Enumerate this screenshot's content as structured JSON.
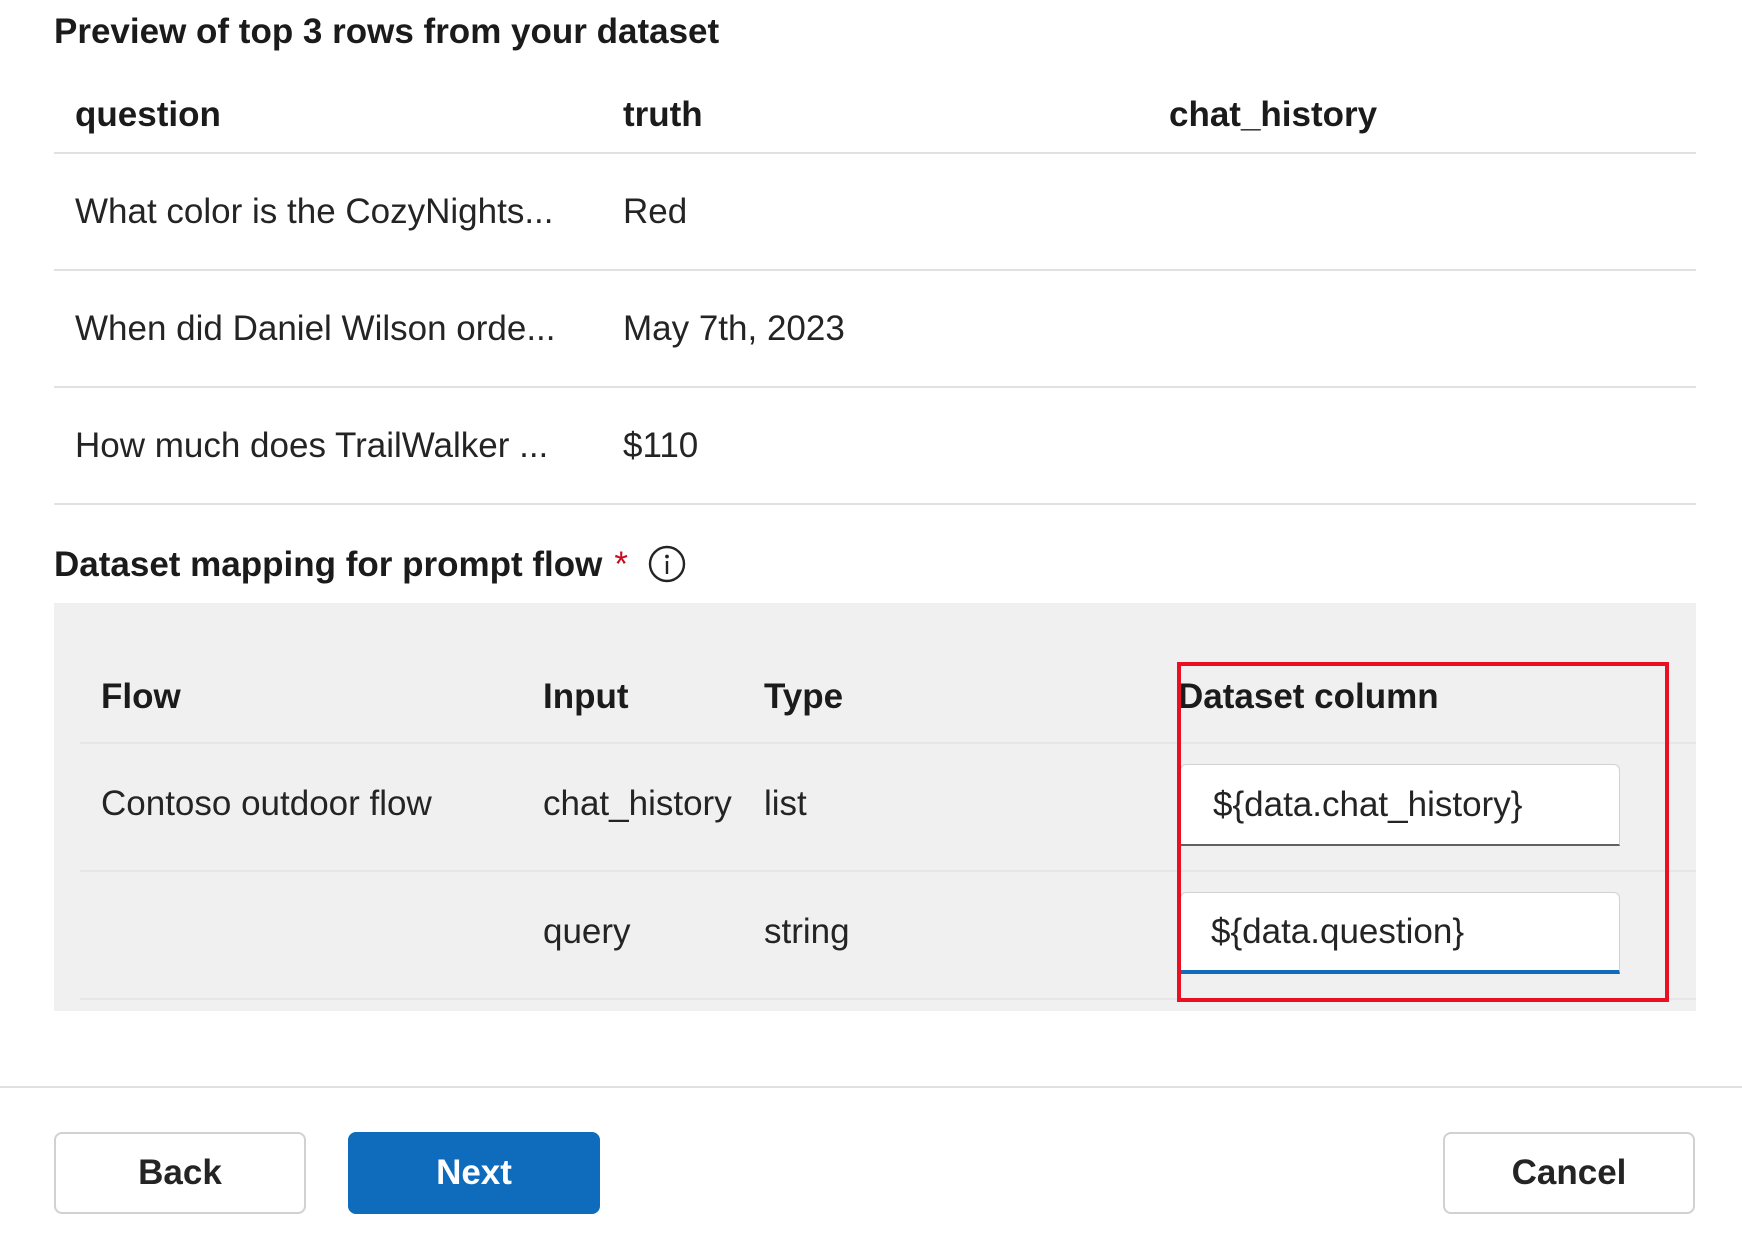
{
  "preview": {
    "title": "Preview of top 3 rows from your dataset",
    "columns": [
      "question",
      "truth",
      "chat_history"
    ],
    "rows": [
      [
        "What color is the CozyNights...",
        "Red",
        ""
      ],
      [
        "When did Daniel Wilson orde...",
        "May 7th, 2023",
        ""
      ],
      [
        "How much does TrailWalker ...",
        "$110",
        ""
      ]
    ]
  },
  "mapping": {
    "title": "Dataset mapping for prompt flow",
    "required_marker": "*",
    "info_icon": "info-icon",
    "columns": [
      "Flow",
      "Input",
      "Type",
      "Dataset column"
    ],
    "rows": [
      {
        "flow": "Contoso outdoor flow",
        "input": "chat_history",
        "type": "list",
        "dataset_column": "${data.chat_history}"
      },
      {
        "flow": "",
        "input": "query",
        "type": "string",
        "dataset_column": "${data.question}"
      }
    ]
  },
  "footer": {
    "back_label": "Back",
    "next_label": "Next",
    "cancel_label": "Cancel"
  },
  "colors": {
    "primary": "#0f6cbd",
    "required": "#c50f1f",
    "highlight": "#e81123",
    "panel_bg": "#f0f0f0"
  }
}
